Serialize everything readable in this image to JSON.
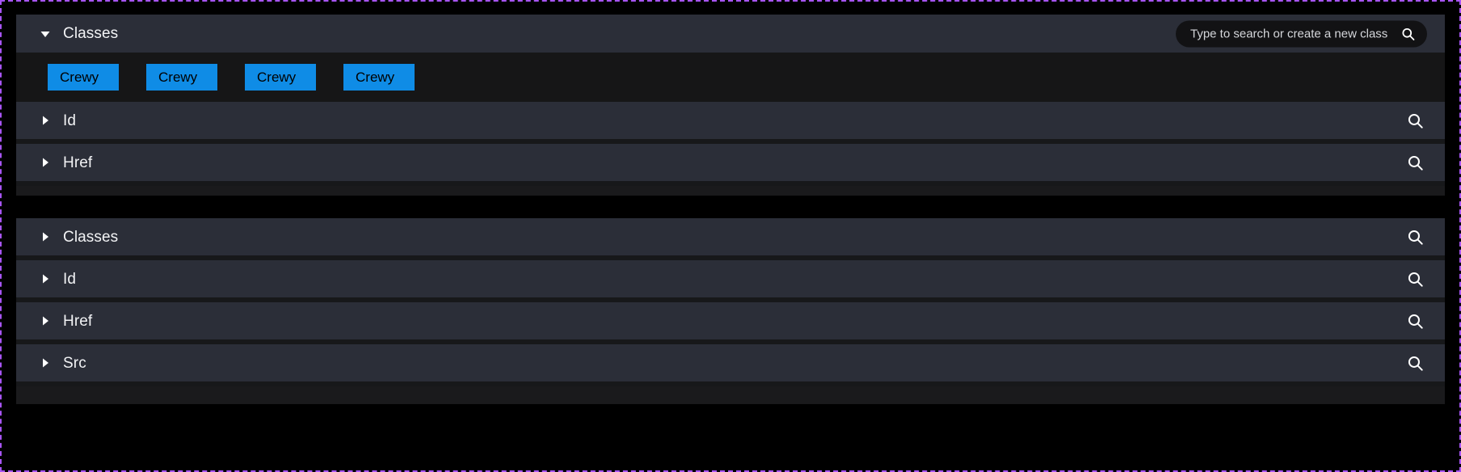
{
  "panels": [
    {
      "name": "element-attributes-panel",
      "header": {
        "label": "Classes",
        "caret": "caret-down-icon",
        "expanded": true,
        "search": {
          "placeholder": "Type to search or create a new class",
          "value": "",
          "icon": "search-icon"
        }
      },
      "chips": [
        {
          "label": "Crewy"
        },
        {
          "label": "Crewy"
        },
        {
          "label": "Crewy"
        },
        {
          "label": "Crewy"
        }
      ],
      "rows": [
        {
          "label": "Id",
          "caret": "caret-right-icon",
          "expanded": false,
          "icon": "search-icon"
        },
        {
          "label": "Href",
          "caret": "caret-right-icon",
          "expanded": false,
          "icon": "search-icon"
        }
      ]
    },
    {
      "name": "secondary-attributes-panel",
      "rows": [
        {
          "label": "Classes",
          "caret": "caret-right-icon",
          "expanded": false,
          "icon": "search-icon"
        },
        {
          "label": "Id",
          "caret": "caret-right-icon",
          "expanded": false,
          "icon": "search-icon"
        },
        {
          "label": "Href",
          "caret": "caret-right-icon",
          "expanded": false,
          "icon": "search-icon"
        },
        {
          "label": "Src",
          "caret": "caret-right-icon",
          "expanded": false,
          "icon": "search-icon"
        }
      ]
    }
  ],
  "colors": {
    "accent_chip": "#0f8ce6",
    "row_background": "#2b2e38",
    "panel_background": "#17181a",
    "page_background": "#000000",
    "selection_border": "#a855f7",
    "label_text": "#f2f3f5"
  }
}
